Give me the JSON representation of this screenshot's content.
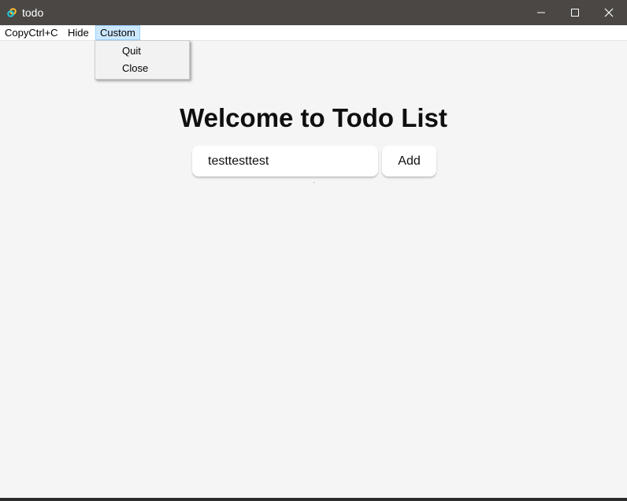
{
  "window": {
    "title": "todo",
    "app_icon": "tauri-logo-icon",
    "controls": [
      "minimize-icon",
      "maximize-icon",
      "close-icon"
    ]
  },
  "menubar": {
    "items": [
      {
        "label": "CopyCtrl+C"
      },
      {
        "label": "Hide"
      },
      {
        "label": "Custom",
        "state": "open"
      }
    ],
    "dropdown": {
      "items": [
        {
          "label": "Quit"
        },
        {
          "label": "Close"
        }
      ]
    }
  },
  "main": {
    "heading": "Welcome to Todo List",
    "input": {
      "value": "testtesttest",
      "placeholder": ""
    },
    "add_button": "Add"
  },
  "colors": {
    "titlebar": "#4a4744",
    "menu_highlight": "#cce8ff",
    "background": "#f5f5f5"
  }
}
